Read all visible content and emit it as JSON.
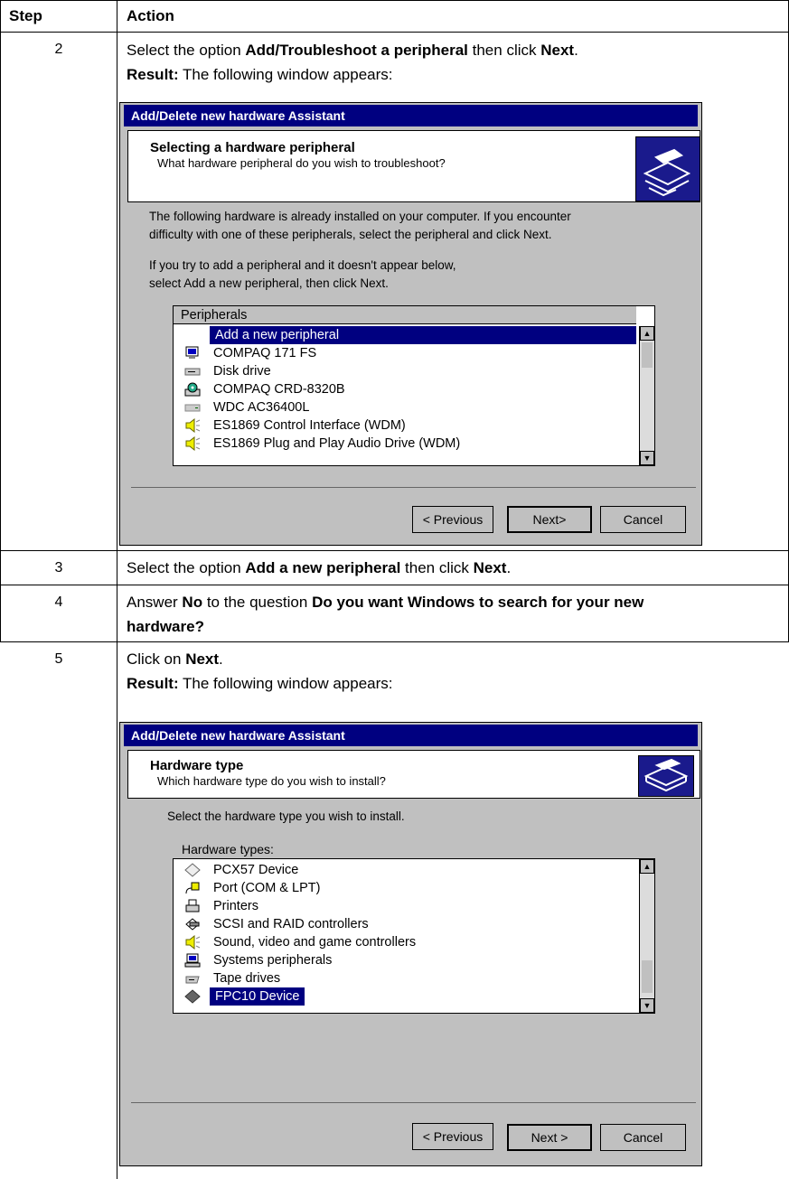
{
  "table": {
    "headers": {
      "step": "Step",
      "action": "Action"
    },
    "rows": [
      {
        "step": "2",
        "line1": {
          "pre": "Select the option ",
          "bold": "Add/Troubleshoot a peripheral",
          "mid": " then click ",
          "bold2": "Next",
          "post": "."
        },
        "line2": {
          "bold": "Result:",
          "post": " The following window appears:"
        }
      },
      {
        "step": "3",
        "line1": {
          "pre": "Select the option ",
          "bold": "Add a new peripheral",
          "mid": " then click ",
          "bold2": "Next",
          "post": "."
        }
      },
      {
        "step": "4",
        "line1": {
          "pre": "Answer ",
          "bold": "No",
          "mid": " to the question ",
          "bold2": "Do you want Windows to search for your new"
        },
        "line2": {
          "bold": "hardware?"
        }
      },
      {
        "step": "5",
        "line1": {
          "pre": "Click on ",
          "bold": "Next",
          "post": "."
        },
        "line2": {
          "bold": "Result:",
          "post": " The following window appears:"
        }
      }
    ]
  },
  "dialog1": {
    "title": "Add/Delete new hardware Assistant",
    "heading": "Selecting a hardware peripheral",
    "subheading": "What hardware peripheral do you wish to troubleshoot?",
    "para1a": "The following hardware is already installed on your computer. If you encounter",
    "para1b": "difficulty with one of these peripherals, select the peripheral and click Next.",
    "para2a": "If you try to add a peripheral and it doesn't appear below,",
    "para2b": "select Add a new peripheral, then click Next.",
    "list_header": "Peripherals",
    "items": [
      {
        "label": "Add a new peripheral",
        "icon": "none"
      },
      {
        "label": "COMPAQ 171 FS",
        "icon": "monitor-icon"
      },
      {
        "label": "Disk drive",
        "icon": "disk-drive-icon"
      },
      {
        "label": "COMPAQ CRD-8320B",
        "icon": "cdrom-icon"
      },
      {
        "label": "WDC AC36400L",
        "icon": "hard-drive-icon"
      },
      {
        "label": "ES1869 Control Interface (WDM)",
        "icon": "speaker-icon"
      },
      {
        "label": "ES1869 Plug and Play Audio Drive (WDM)",
        "icon": "speaker-icon"
      }
    ],
    "selected": "Add a new peripheral",
    "btn_prev": "< Previous",
    "btn_next": "Next>",
    "btn_cancel": "Cancel"
  },
  "dialog2": {
    "title": "Add/Delete new hardware Assistant",
    "heading": "Hardware type",
    "subheading": "Which hardware type do you wish to install?",
    "para": "Select the hardware type you wish to install.",
    "list_label": "Hardware types:",
    "items": [
      {
        "label": "PCX57 Device",
        "icon": "diamond-icon"
      },
      {
        "label": "Port (COM & LPT)",
        "icon": "port-icon"
      },
      {
        "label": "Printers",
        "icon": "printer-icon"
      },
      {
        "label": "SCSI and RAID controllers",
        "icon": "scsi-icon"
      },
      {
        "label": "Sound, video and game controllers",
        "icon": "speaker-icon"
      },
      {
        "label": "Systems peripherals",
        "icon": "computer-icon"
      },
      {
        "label": "Tape drives",
        "icon": "tape-drive-icon"
      },
      {
        "label": "FPC10 Device",
        "icon": "diamond-icon"
      }
    ],
    "selected": "FPC10 Device",
    "btn_prev": "< Previous",
    "btn_next": "Next >",
    "btn_cancel": "Cancel"
  },
  "colors": {
    "titlebar": "#000080",
    "selection": "#000080",
    "dialog_bg": "#c0c0c0"
  }
}
